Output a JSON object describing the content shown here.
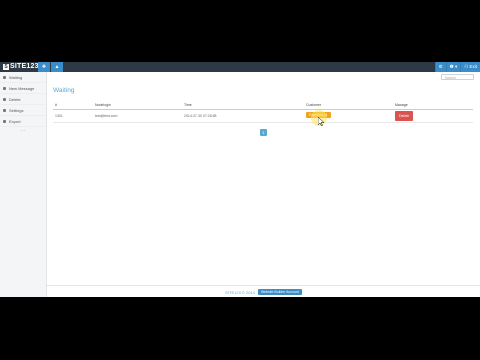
{
  "topbar": {
    "logo_mark": "S",
    "logo_text": "SITE123",
    "btn1_glyph": "✚",
    "btn2_glyph": "▲",
    "right_items": [
      {
        "glyph": "⚙"
      },
      {
        "glyph": "❶ ▾"
      },
      {
        "glyph": "⚇ Exit"
      }
    ]
  },
  "sidebar": {
    "items": [
      {
        "label": "Waiting"
      },
      {
        "label": "New Message"
      },
      {
        "label": "Delete"
      },
      {
        "label": "Settings"
      },
      {
        "label": "Export"
      }
    ],
    "more": "..."
  },
  "search": {
    "placeholder": "Search"
  },
  "page": {
    "title": "Waiting"
  },
  "table": {
    "headers": [
      "#",
      "Nodelogin",
      "Time",
      "Customer",
      "Manage"
    ],
    "rows": [
      {
        "id": "1301",
        "nodelogin": "test@test.com",
        "time": "2014-07-30 07:26:58",
        "status": "Payment #1",
        "action": "Delete"
      }
    ]
  },
  "pager": {
    "current": "1"
  },
  "footer": {
    "text": "SITE123 © 2014",
    "button": "Website Builder Account"
  },
  "colors": {
    "accent": "#3a8dc8",
    "topbar": "#2d3a45",
    "warning": "#f0a521",
    "danger": "#d9534f"
  }
}
